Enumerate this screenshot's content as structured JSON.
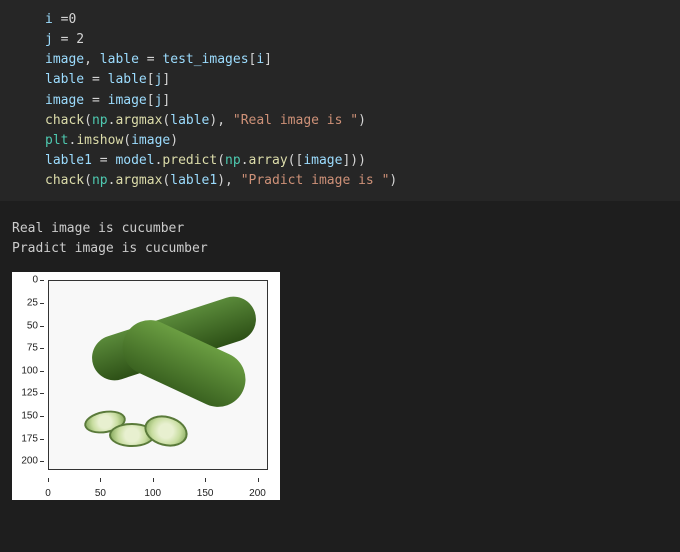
{
  "code": {
    "line1_var": "i",
    "line1_rest": " =0",
    "line2_var": "j",
    "line2_rest": " = 2",
    "line3_a": "image",
    "line3_b": ", ",
    "line3_c": "lable",
    "line3_d": " = ",
    "line3_e": "test_images",
    "line3_f": "[",
    "line3_g": "i",
    "line3_h": "]",
    "line4_a": "lable",
    "line4_b": " = ",
    "line4_c": "lable",
    "line4_d": "[",
    "line4_e": "j",
    "line4_f": "]",
    "line5_a": "image",
    "line5_b": " = ",
    "line5_c": "image",
    "line5_d": "[",
    "line5_e": "j",
    "line5_f": "]",
    "line6_a": "chack",
    "line6_b": "(",
    "line6_c": "np",
    "line6_d": ".",
    "line6_e": "argmax",
    "line6_f": "(",
    "line6_g": "lable",
    "line6_h": "), ",
    "line6_i": "\"Real image is \"",
    "line6_j": ")",
    "line7_a": "plt",
    "line7_b": ".",
    "line7_c": "imshow",
    "line7_d": "(",
    "line7_e": "image",
    "line7_f": ")",
    "line8_a": "lable1",
    "line8_b": " = ",
    "line8_c": "model",
    "line8_d": ".",
    "line8_e": "predict",
    "line8_f": "(",
    "line8_g": "np",
    "line8_h": ".",
    "line8_i": "array",
    "line8_j": "([",
    "line8_k": "image",
    "line8_l": "]))",
    "line9_a": "chack",
    "line9_b": "(",
    "line9_c": "np",
    "line9_d": ".",
    "line9_e": "argmax",
    "line9_f": "(",
    "line9_g": "lable1",
    "line9_h": "), ",
    "line9_i": "\"Pradict image is \"",
    "line9_j": ")"
  },
  "output": {
    "line1": "Real image is cucumber",
    "line2": "Pradict image is cucumber"
  },
  "chart_data": {
    "type": "image",
    "description": "matplotlib imshow of a cucumber photo",
    "y_ticks": [
      "0",
      "25",
      "50",
      "75",
      "100",
      "125",
      "150",
      "175",
      "200"
    ],
    "x_ticks": [
      "0",
      "50",
      "100",
      "150",
      "200"
    ],
    "xlim": [
      0,
      210
    ],
    "ylim": [
      210,
      0
    ],
    "image_subject": "cucumber"
  }
}
